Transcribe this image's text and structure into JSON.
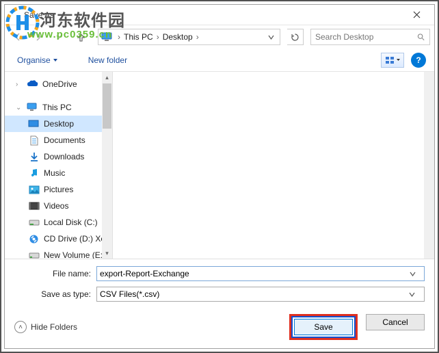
{
  "window": {
    "title": "Save As"
  },
  "watermark": {
    "brand": "河东软件园",
    "url": "www.pc0359.cn"
  },
  "nav": {
    "breadcrumb": [
      "This PC",
      "Desktop"
    ],
    "search_placeholder": "Search Desktop"
  },
  "toolbar": {
    "organise": "Organise",
    "new_folder": "New folder"
  },
  "tree": {
    "items": [
      {
        "label": "OneDrive",
        "icon": "cloud",
        "indent": 0
      },
      {
        "label": "This PC",
        "icon": "pc",
        "indent": 0,
        "expandable": true
      },
      {
        "label": "Desktop",
        "icon": "desktop",
        "indent": 1,
        "selected": true
      },
      {
        "label": "Documents",
        "icon": "doc",
        "indent": 1
      },
      {
        "label": "Downloads",
        "icon": "download",
        "indent": 1
      },
      {
        "label": "Music",
        "icon": "music",
        "indent": 1
      },
      {
        "label": "Pictures",
        "icon": "picture",
        "indent": 1
      },
      {
        "label": "Videos",
        "icon": "video",
        "indent": 1
      },
      {
        "label": "Local Disk (C:)",
        "icon": "disk",
        "indent": 1
      },
      {
        "label": "CD Drive (D:) Xen",
        "icon": "cd",
        "indent": 1
      },
      {
        "label": "New Volume (E:)",
        "icon": "disk",
        "indent": 1
      }
    ]
  },
  "fields": {
    "filename_label": "File name:",
    "filename_value": "export-Report-Exchange",
    "type_label": "Save as type:",
    "type_value": "CSV Files(*.csv)"
  },
  "buttons": {
    "hide_folders": "Hide Folders",
    "save": "Save",
    "cancel": "Cancel"
  }
}
